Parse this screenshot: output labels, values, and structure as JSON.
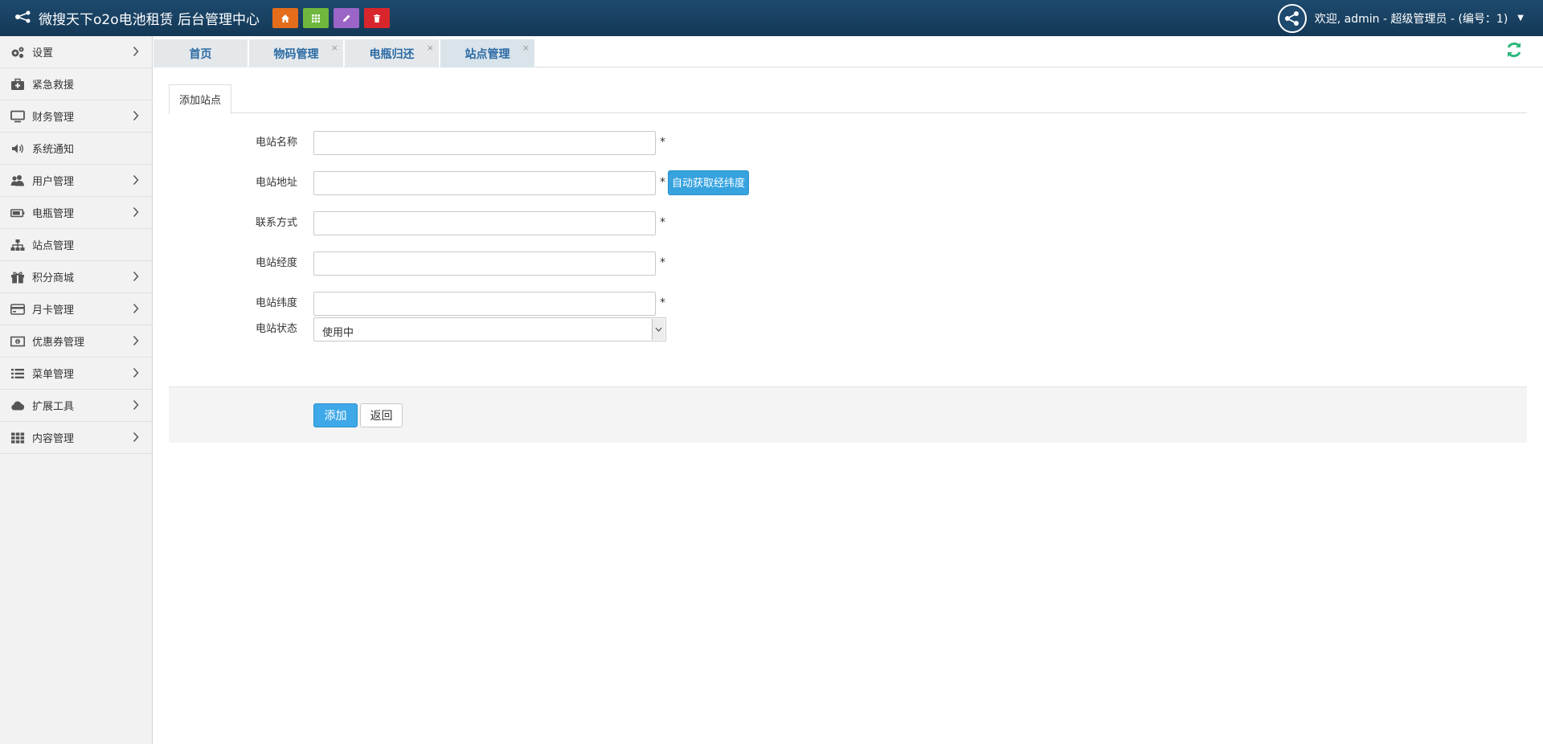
{
  "header": {
    "title": "微搜天下o2o电池租赁 后台管理中心",
    "quick_buttons": [
      {
        "icon": "home-icon",
        "color": "#e36d1b"
      },
      {
        "icon": "grid-icon",
        "color": "#6fb83d"
      },
      {
        "icon": "pencil-icon",
        "color": "#9a65c6"
      },
      {
        "icon": "trash-icon",
        "color": "#d9262c"
      }
    ],
    "user_text": "欢迎, admin - 超级管理员 - (编号：1)"
  },
  "sidebar": {
    "items": [
      {
        "label": "设置",
        "icon": "gears-icon",
        "has_arrow": true
      },
      {
        "label": "紧急救援",
        "icon": "medkit-icon",
        "has_arrow": false
      },
      {
        "label": "财务管理",
        "icon": "monitor-icon",
        "has_arrow": true
      },
      {
        "label": "系统通知",
        "icon": "speaker-icon",
        "has_arrow": false
      },
      {
        "label": "用户管理",
        "icon": "users-icon",
        "has_arrow": true
      },
      {
        "label": "电瓶管理",
        "icon": "battery-icon",
        "has_arrow": true
      },
      {
        "label": "站点管理",
        "icon": "sitemap-icon",
        "has_arrow": false
      },
      {
        "label": "积分商城",
        "icon": "gift-icon",
        "has_arrow": true
      },
      {
        "label": "月卡管理",
        "icon": "credit-card-icon",
        "has_arrow": true
      },
      {
        "label": "优惠券管理",
        "icon": "money-icon",
        "has_arrow": true
      },
      {
        "label": "菜单管理",
        "icon": "list-icon",
        "has_arrow": true
      },
      {
        "label": "扩展工具",
        "icon": "cloud-icon",
        "has_arrow": true
      },
      {
        "label": "内容管理",
        "icon": "apps-icon",
        "has_arrow": true
      }
    ]
  },
  "tabs": [
    {
      "label": "首页",
      "closable": false
    },
    {
      "label": "物码管理",
      "closable": true
    },
    {
      "label": "电瓶归还",
      "closable": true
    },
    {
      "label": "站点管理",
      "closable": true,
      "active": true
    }
  ],
  "tab_close_symbol": "×",
  "form": {
    "tab_label": "添加站点",
    "fields": [
      {
        "label": "电站名称",
        "value": "",
        "required": true
      },
      {
        "label": "电站地址",
        "value": "",
        "required": true
      },
      {
        "label": "联系方式",
        "value": "",
        "required": true
      },
      {
        "label": "电站经度",
        "value": "",
        "required": true
      },
      {
        "label": "电站纬度",
        "value": "",
        "required": true
      }
    ],
    "required_mark": "*",
    "geo_button": "自动获取经纬度",
    "status_label": "电站状态",
    "status_value": "使用中",
    "submit_label": "添加",
    "back_label": "返回"
  },
  "colors": {
    "header_bg": "#1d4a6e",
    "primary_button": "#3ea8e8",
    "tab_text": "#2a6aa3",
    "refresh": "#2bb87a"
  }
}
